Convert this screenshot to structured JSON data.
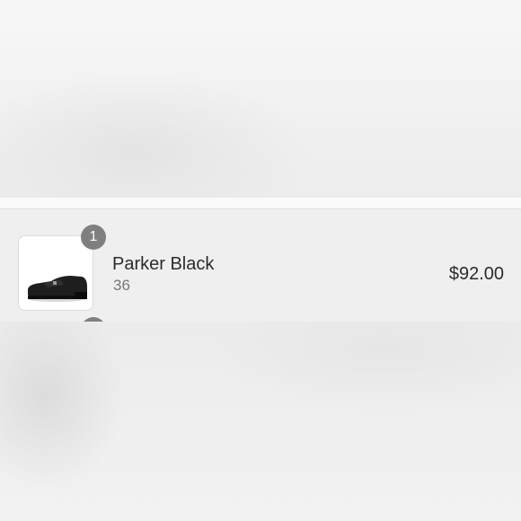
{
  "cart": {
    "items": [
      {
        "quantity": "1",
        "name": "Parker Black",
        "variant": "36",
        "price": "$92.00",
        "image_icon": "black-loafer-shoe-icon"
      }
    ]
  }
}
